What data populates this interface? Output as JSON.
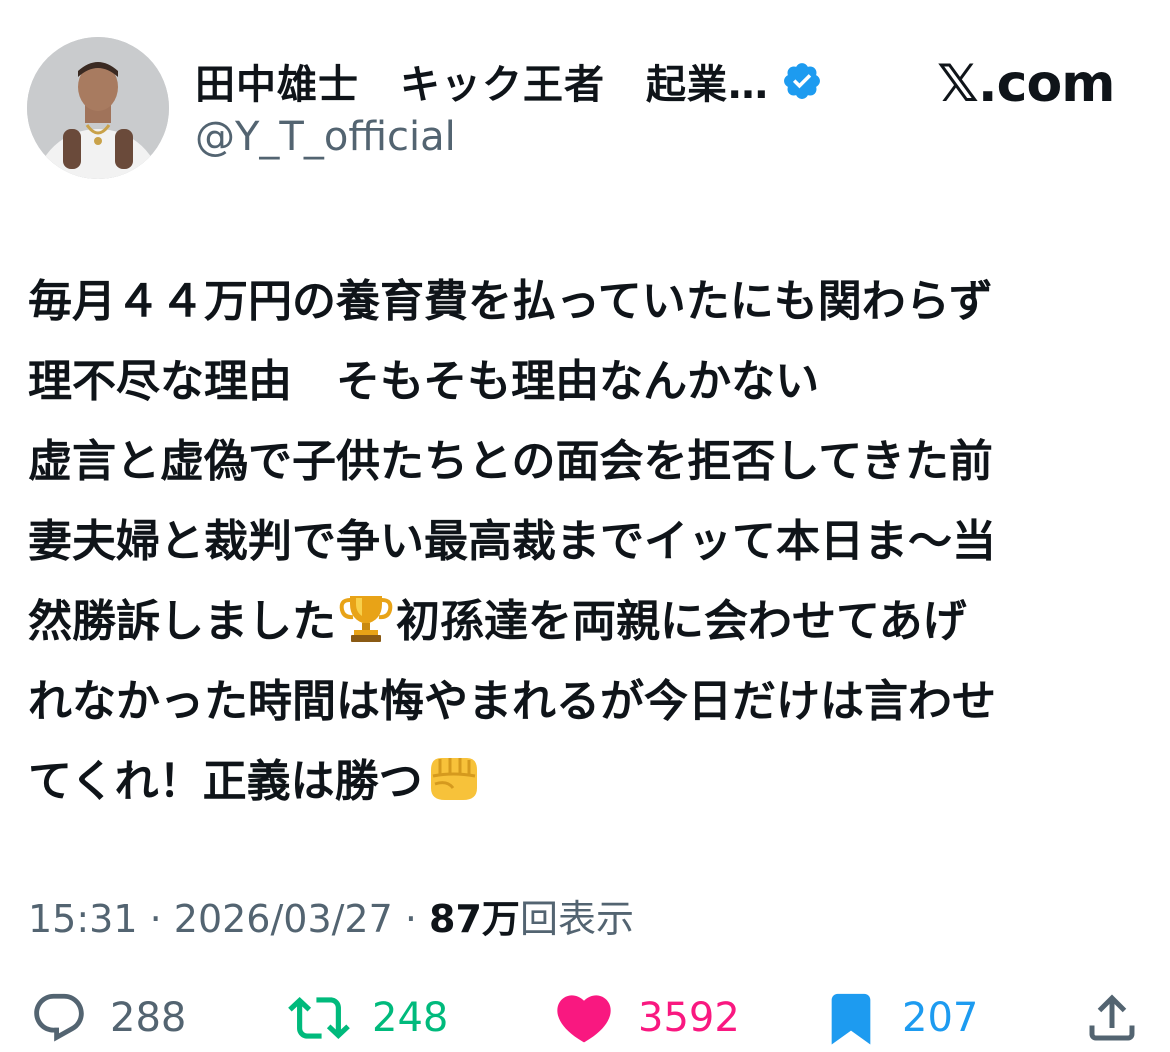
{
  "header": {
    "display_name": "田中雄士　キック王者　起業…",
    "handle": "@Y_T_official",
    "brand": "𝕏.com",
    "verified_icon": "verified-badge-icon"
  },
  "tweet": {
    "text_before_trophy": "毎月４４万円の養育費を払っていたにも関わらず\n理不尽な理由　そもそも理由なんかない\n虚言と虚偽で子供たちとの面会を拒否してきた前\n妻夫婦と裁判で争い最高裁までイッて本日ま〜当\n然勝訴しました",
    "text_after_trophy": "初孫達を両親に会わせてあげ\nれなかった時間は悔やまれるが今日だけは言わせ\nてくれ！正義は勝つ",
    "emoji_trophy": "trophy-emoji",
    "emoji_fist": "fist-emoji"
  },
  "meta": {
    "time": "15:31",
    "separator": " · ",
    "date": "2026/03/27",
    "views_count": "87万",
    "views_label": "回表示"
  },
  "actions": {
    "replies": "288",
    "retweets": "248",
    "likes": "3592",
    "bookmarks": "207"
  },
  "colors": {
    "text": "#0f1419",
    "secondary": "#536471",
    "verified": "#1d9bf0",
    "retweet": "#00ba7c",
    "like": "#f91880",
    "bookmark": "#1d9bf0"
  }
}
